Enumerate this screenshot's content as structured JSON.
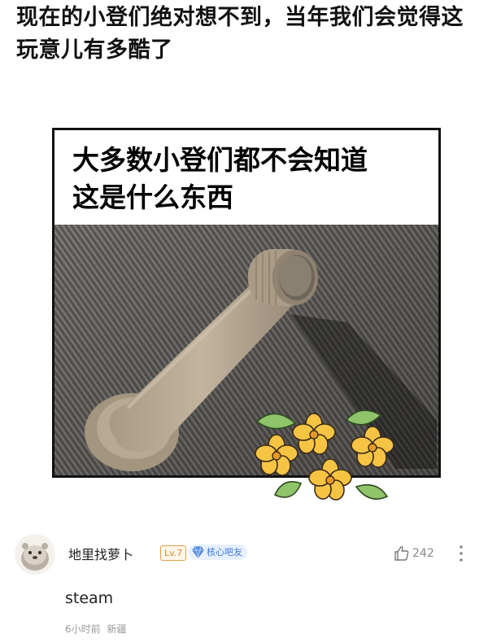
{
  "post": {
    "title": "现在的小登们绝对想不到，当年我们会觉得这玩意儿有多酷了"
  },
  "meme": {
    "caption_line1": "大多数小登们都不会知道",
    "caption_line2": "这是什么东西",
    "photo_icon": "car-window-crank-photo",
    "sticker_icon": "osmanthus-flower-sticker"
  },
  "comment": {
    "username": "地里找萝卜",
    "level_badge": "Lv.7",
    "member_badge": "核心吧友",
    "like_count": "242",
    "text": "steam",
    "time": "6小时前",
    "location": "新疆"
  },
  "colors": {
    "level_badge": "#d98a2b",
    "member_badge_bg": "#e7f0ff",
    "member_badge_text": "#3b78d8",
    "meta_text": "#9a9a9a",
    "crank_handle": "#b9aa94"
  }
}
